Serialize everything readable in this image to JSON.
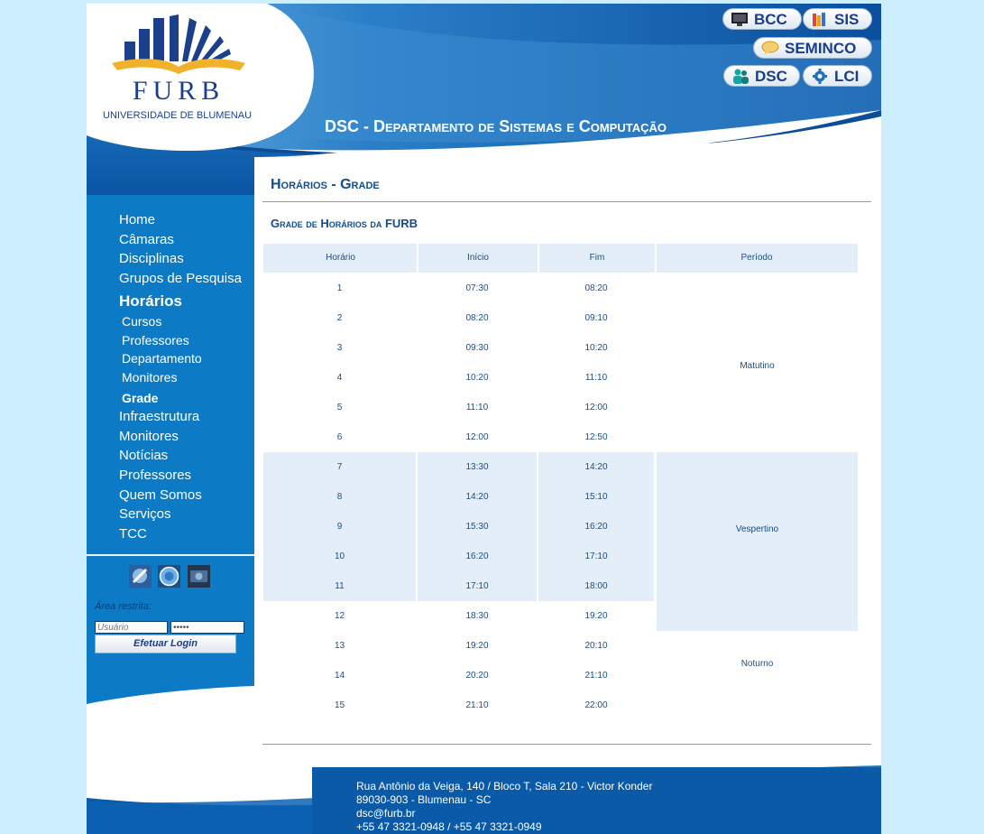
{
  "colors": {
    "page_bg": "#cdeefc",
    "header_blue": "#0a5aa8",
    "sidebar_blue": "#0c7ac4",
    "title_blue": "#114c8d",
    "table_shade": "#e3eef8"
  },
  "header": {
    "logo": {
      "name": "FURB",
      "subtitle": "UNIVERSIDADE DE BLUMENAU"
    },
    "buttons": {
      "bcc": {
        "label": "BCC",
        "icon": "monitor-icon"
      },
      "sis": {
        "label": "SIS",
        "icon": "books-icon"
      },
      "seminco": {
        "label": "SEMINCO",
        "icon": "speech-bubble-icon"
      },
      "dsc": {
        "label": "DSC",
        "icon": "people-icon"
      },
      "lci": {
        "label": "LCI",
        "icon": "gear-icon"
      }
    },
    "title_prefix": "DSC - ",
    "title_sc": "Departamento de Sistemas e Computação"
  },
  "sidebar": {
    "nav": [
      "Home",
      "Câmaras",
      "Disciplinas",
      "Grupos de Pesquisa",
      "Horários",
      "Infraestrutura",
      "Monitores",
      "Notícias",
      "Professores",
      "Quem Somos",
      "Serviços",
      "TCC"
    ],
    "subnav": [
      "Cursos",
      "Professores",
      "Departamento",
      "Monitores",
      "Grade"
    ],
    "restricted_label": "Área restrita:",
    "login": {
      "user_placeholder": "Usuário",
      "password_value": "•••••",
      "button_label": "Efetuar Login"
    }
  },
  "content": {
    "title": "Horários - Grade",
    "subtitle": "Grade de Horários da FURB",
    "table": {
      "headers": [
        "Horário",
        "Início",
        "Fim",
        "Período"
      ],
      "rows": [
        [
          "1",
          "07:30",
          "08:20"
        ],
        [
          "2",
          "08:20",
          "09:10"
        ],
        [
          "3",
          "09:30",
          "10:20"
        ],
        [
          "4",
          "10:20",
          "11:10"
        ],
        [
          "5",
          "11:10",
          "12:00"
        ],
        [
          "6",
          "12:00",
          "12:50"
        ],
        [
          "7",
          "13:30",
          "14:20"
        ],
        [
          "8",
          "14:20",
          "15:10"
        ],
        [
          "9",
          "15:30",
          "16:20"
        ],
        [
          "10",
          "16:20",
          "17:10"
        ],
        [
          "11",
          "17:10",
          "18:00"
        ],
        [
          "12",
          "18:30",
          "19:20"
        ],
        [
          "13",
          "19:20",
          "20:10"
        ],
        [
          "14",
          "20:20",
          "21:10"
        ],
        [
          "15",
          "21:10",
          "22:00"
        ]
      ],
      "periods": [
        "Matutino",
        "Vespertino",
        "Noturno"
      ]
    }
  },
  "footer": {
    "address": "Rua Antônio da Veiga, 140 / Bloco T, Sala 210 - Victor Konder",
    "city": "89030-903 - Blumenau - SC",
    "email": "dsc@furb.br",
    "phones": "+55 47 3321-0948 / +55 47 3321-0949"
  }
}
